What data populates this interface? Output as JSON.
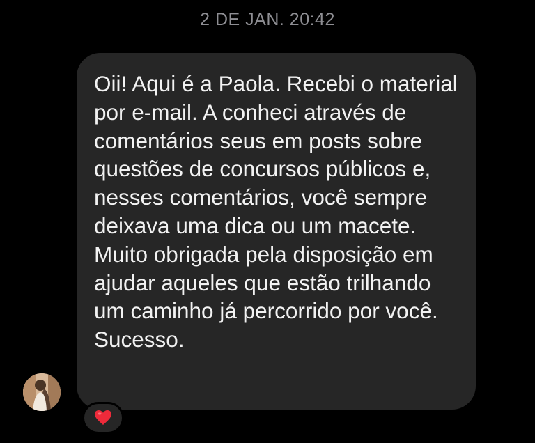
{
  "chat": {
    "timestamp": "2 DE JAN. 20:42",
    "message": {
      "text": "Oii! Aqui é a Paola. Recebi o material por e-mail. A conheci através de comentários seus em posts sobre questões de concursos públicos e, nesses comentários, você sempre deixava uma dica ou um macete. Muito obrigada pela disposição em ajudar aqueles que estão trilhando um caminho já percorrido por você. Sucesso.",
      "reaction": "❤️"
    },
    "sender": {
      "avatar_icon": "profile-photo"
    }
  },
  "colors": {
    "background": "#000000",
    "bubble": "#262626",
    "text": "#f2f2f2",
    "timestamp": "#8e8e93",
    "heart": "#e0245e"
  }
}
